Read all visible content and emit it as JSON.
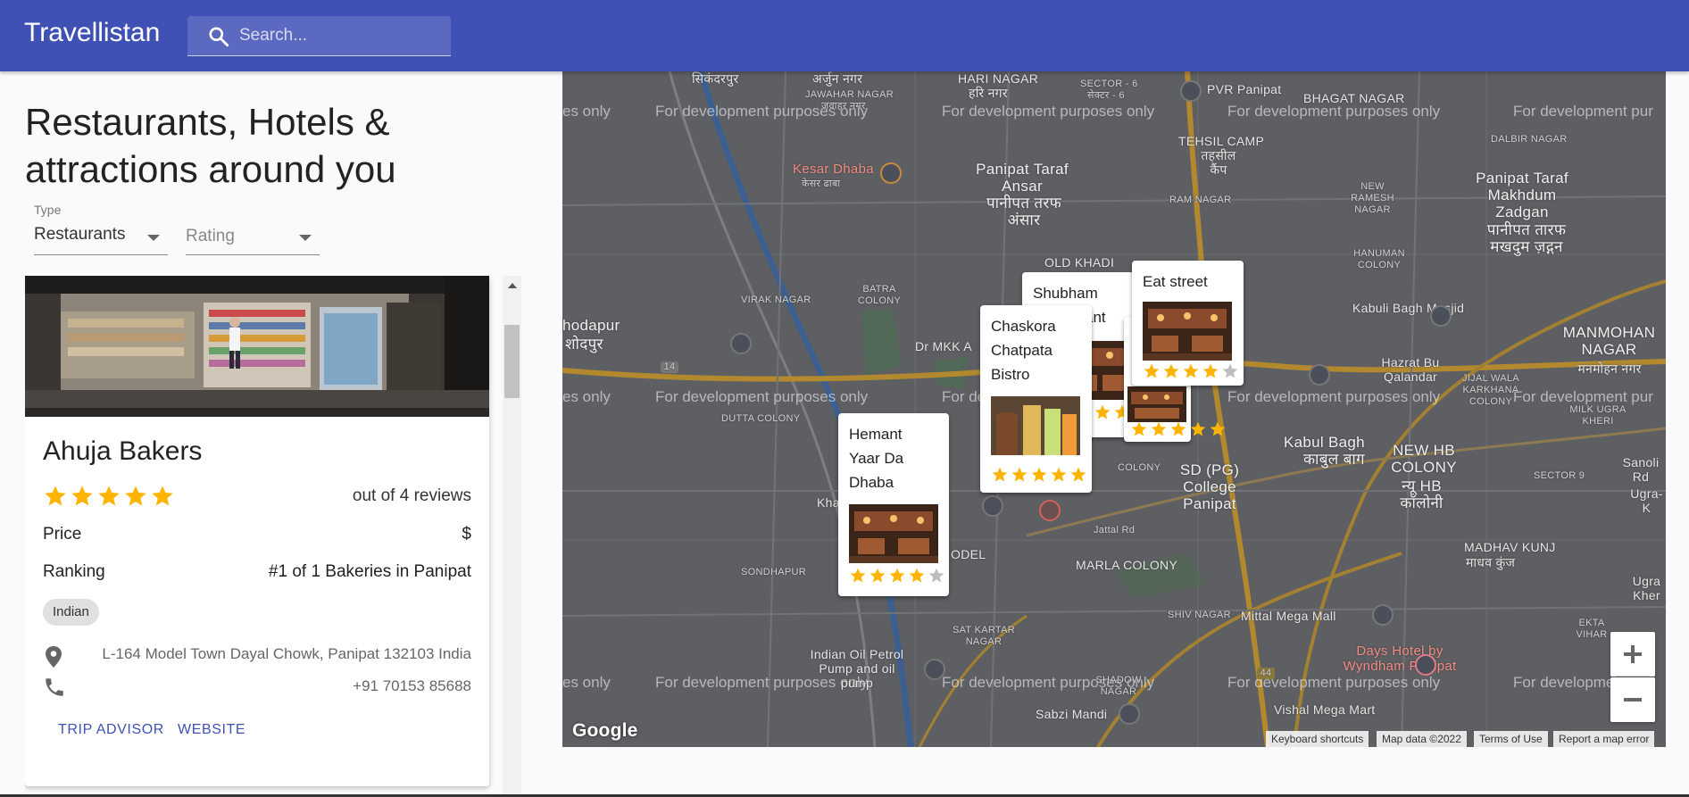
{
  "app": {
    "title": "Travellistan"
  },
  "search": {
    "placeholder": "Search..."
  },
  "page": {
    "heading": "Restaurants, Hotels & attractions around you"
  },
  "filters": {
    "type_label": "Type",
    "type_value": "Restaurants",
    "rating_placeholder": "Rating"
  },
  "place": {
    "name": "Ahuja Bakers",
    "rating": 5,
    "review_text": "out of 4 reviews",
    "price_label": "Price",
    "price_value": "$",
    "ranking_label": "Ranking",
    "ranking_value": "#1 of 1 Bakeries in Panipat",
    "cuisine": "Indian",
    "address": "L-164 Model Town Dayal Chowk, Panipat 132103 India",
    "phone": "+91 70153 85688",
    "link_tripadvisor": "TRIP ADVISOR",
    "link_website": "WEBSITE"
  },
  "map": {
    "watermark": "For development purposes only",
    "watermark_cut_left": "es only",
    "watermark_cut_right": "For development pur",
    "labels": {
      "sikandarpur": "सिकंदरपुर",
      "arjun_nagar": "अर्जुन नगर",
      "jawahar_nagar": "JAWAHAR NAGAR",
      "jawahar_nagar_hi": "जवाहर नगर",
      "hari_nagar": "HARI NAGAR",
      "hari_nagar_hi": "हरि नगर",
      "sector6": "SECTOR - 6",
      "sector6_hi": "सेक्टर - 6",
      "pvr": "PVR Panipat",
      "bhagat_nagar": "BHAGAT NAGAR",
      "tehsil_camp": "TEHSIL CAMP",
      "tehsil_camp_hi": "तहसील कैंप",
      "kesar_dhaba": "Kesar Dhaba",
      "kesar_dhaba_hi": "केसर ढाबा",
      "taraf_ansar": "Panipat Taraf Ansar",
      "taraf_ansar_hi": "पानीपत तरफ अंसार",
      "ram_nagar": "RAM NAGAR",
      "new_ramesh": "NEW RAMESH NAGAR",
      "makhdum": "Panipat Taraf Makhdum Zadgan",
      "makhdum_hi": "पानीपत तारफ मखदुम ज़द्गन",
      "dalbir": "DALBIR NAGAR",
      "old_khadi": "OLD KHADI",
      "hanuman": "HANUMAN COLONY",
      "virak": "VIRAK NAGAR",
      "batra": "BATRA COLONY",
      "kabuli_masjid": "Kabuli Bagh Masjid",
      "manmohan": "MANMOHAN NAGAR",
      "manmohan_hi": "मनमोहन नगर",
      "hodapur": "hodapur",
      "hodapur_hi": "शोदपुर",
      "hazrat": "Hazrat Bu Qalandar",
      "jiwal": "JIJAL WALA KARKHANA COLONY",
      "milk_ugra": "MILK UGRA KHERI",
      "dutta": "DUTTA COLONY",
      "kabul_bagh": "Kabul Bagh",
      "kabul_bagh_hi": "काबुल बाग",
      "new_hb": "NEW HB COLONY",
      "new_hb_hi": "न्यू HB कॉलोनी",
      "sector9": "SECTOR 9",
      "sd_college": "SD (PG) College Panipat",
      "jattal": "Jattal Rd",
      "madhav": "MADHAV KUNJ",
      "madhav_hi": "माधव कुंज",
      "sondhapur": "SONDHAPUR",
      "marla": "MARLA COLONY",
      "shiv_nagar": "SHIV NAGAR",
      "mittal": "Mittal Mega Mall",
      "ugra_kher": "Ugra Kher",
      "ekta_vihar": "EKTA VIHAR",
      "sat_kartar": "SAT KARTAR NAGAR",
      "indian_oil": "Indian Oil Petrol Pump and oil pump",
      "shadow_nagar": "SHADOW NAGAR",
      "days_hotel": "Days Hotel by Wyndham Panipat",
      "sabzi": "Sabzi Mandi",
      "vishal": "Vishal Mega Mart",
      "road_14": "14",
      "road_44": "44",
      "khan": "Kha",
      "model": "ODEL",
      "dr_mkk": "Dr MKK A",
      "sanoli": "Sanoli Rd",
      "colony": "COLONY",
      "ugra_k": "Ugra-K"
    },
    "popups": [
      {
        "name_lines": [
          "Hemant",
          "Yaar Da",
          "Dhaba"
        ],
        "rating": 4
      },
      {
        "name_lines": [
          "Chaskora",
          "Chatpata",
          "Bistro"
        ],
        "rating": 5
      },
      {
        "name_lines": [
          "Shubham",
          "ant"
        ],
        "rating": 3
      },
      {
        "name_lines": [
          "Eat street"
        ],
        "rating": 4
      },
      {
        "name_lines": [],
        "rating": 5
      }
    ],
    "google": "Google",
    "attribution": {
      "shortcuts": "Keyboard shortcuts",
      "data": "Map data ©2022",
      "terms": "Terms of Use",
      "report": "Report a map error"
    }
  },
  "colors": {
    "appbar": "#3f51b5",
    "star": "#ffb400",
    "star_empty": "#bdbdbd",
    "link": "#3f51b5"
  }
}
